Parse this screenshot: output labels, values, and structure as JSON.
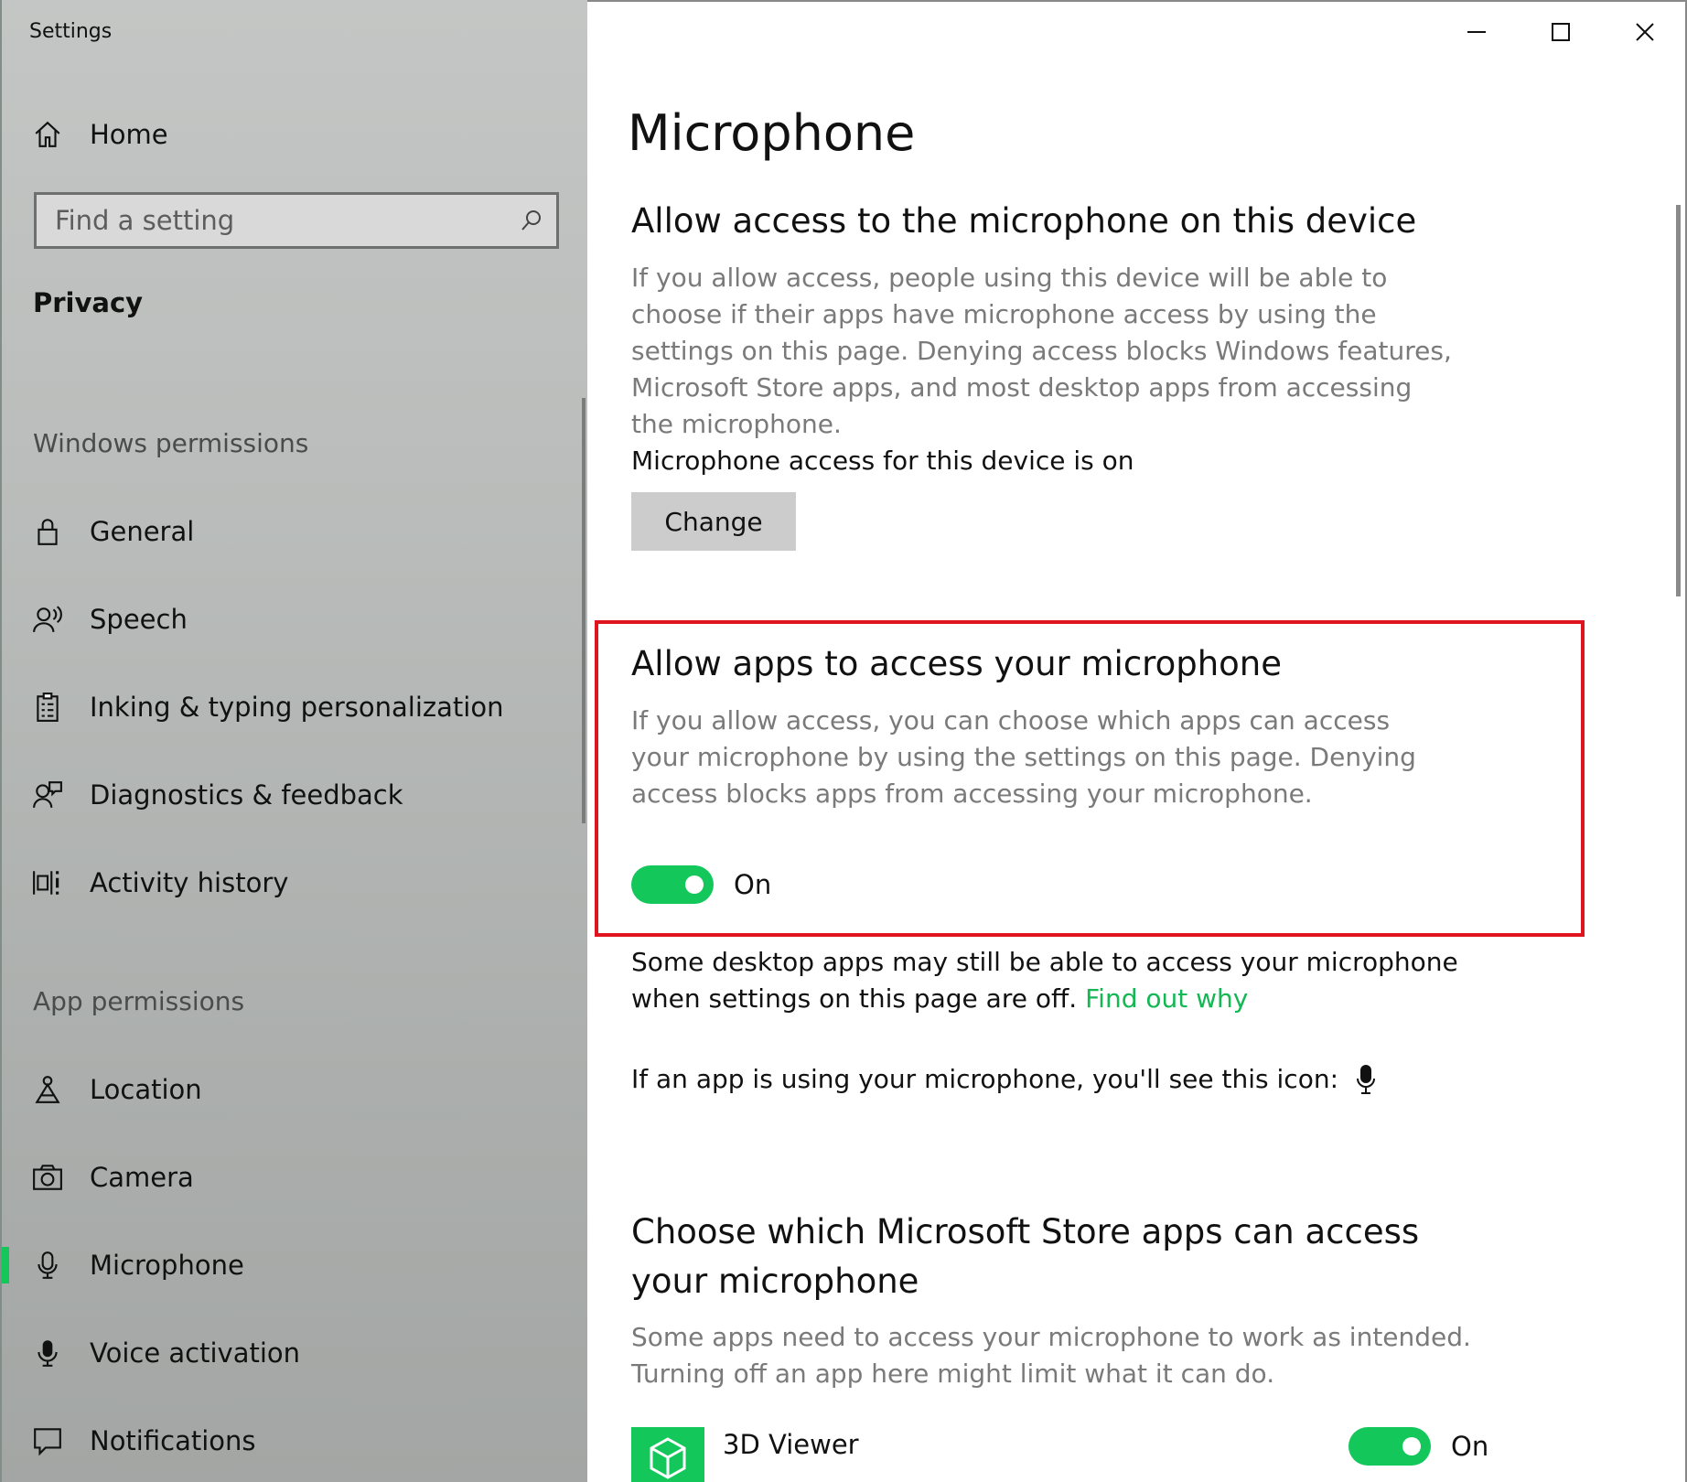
{
  "window": {
    "title": "Settings"
  },
  "sidebar": {
    "home_label": "Home",
    "search_placeholder": "Find a setting",
    "section_title": "Privacy",
    "windows_permissions": {
      "title": "Windows permissions",
      "items": [
        {
          "label": "General",
          "icon": "lock-icon"
        },
        {
          "label": "Speech",
          "icon": "speech-icon"
        },
        {
          "label": "Inking & typing personalization",
          "icon": "clipboard-icon"
        },
        {
          "label": "Diagnostics & feedback",
          "icon": "diagnostics-icon"
        },
        {
          "label": "Activity history",
          "icon": "activity-icon"
        }
      ]
    },
    "app_permissions": {
      "title": "App permissions",
      "items": [
        {
          "label": "Location",
          "icon": "location-icon"
        },
        {
          "label": "Camera",
          "icon": "camera-icon"
        },
        {
          "label": "Microphone",
          "icon": "microphone-icon",
          "active": true
        },
        {
          "label": "Voice activation",
          "icon": "voice-activation-icon"
        },
        {
          "label": "Notifications",
          "icon": "notifications-icon"
        }
      ]
    }
  },
  "main": {
    "page_title": "Microphone",
    "device_section": {
      "title": "Allow access to the microphone on this device",
      "description": "If you allow access, people using this device will be able to choose if their apps have microphone access by using the settings on this page. Denying access blocks Windows features, Microsoft Store apps, and most desktop apps from accessing the microphone.",
      "status": "Microphone access for this device is on",
      "change_button": "Change"
    },
    "apps_section": {
      "title": "Allow apps to access your microphone",
      "description": "If you allow access, you can choose which apps can access your microphone by using the settings on this page. Denying access blocks apps from accessing your microphone.",
      "toggle_state": "On"
    },
    "desktop_note": "Some desktop apps may still be able to access your microphone when settings on this page are off.",
    "find_out_link": "Find out why",
    "icon_note": "If an app is using your microphone, you'll see this icon:",
    "store_section": {
      "title": "Choose which Microsoft Store apps can access your microphone",
      "description": "Some apps need to access your microphone to work as intended. Turning off an app here might limit what it can do."
    },
    "apps": [
      {
        "name": "3D Viewer",
        "toggle_state": "On"
      }
    ]
  },
  "colors": {
    "accent": "#13c75a",
    "highlight": "#e0141e",
    "link": "#13b753"
  }
}
